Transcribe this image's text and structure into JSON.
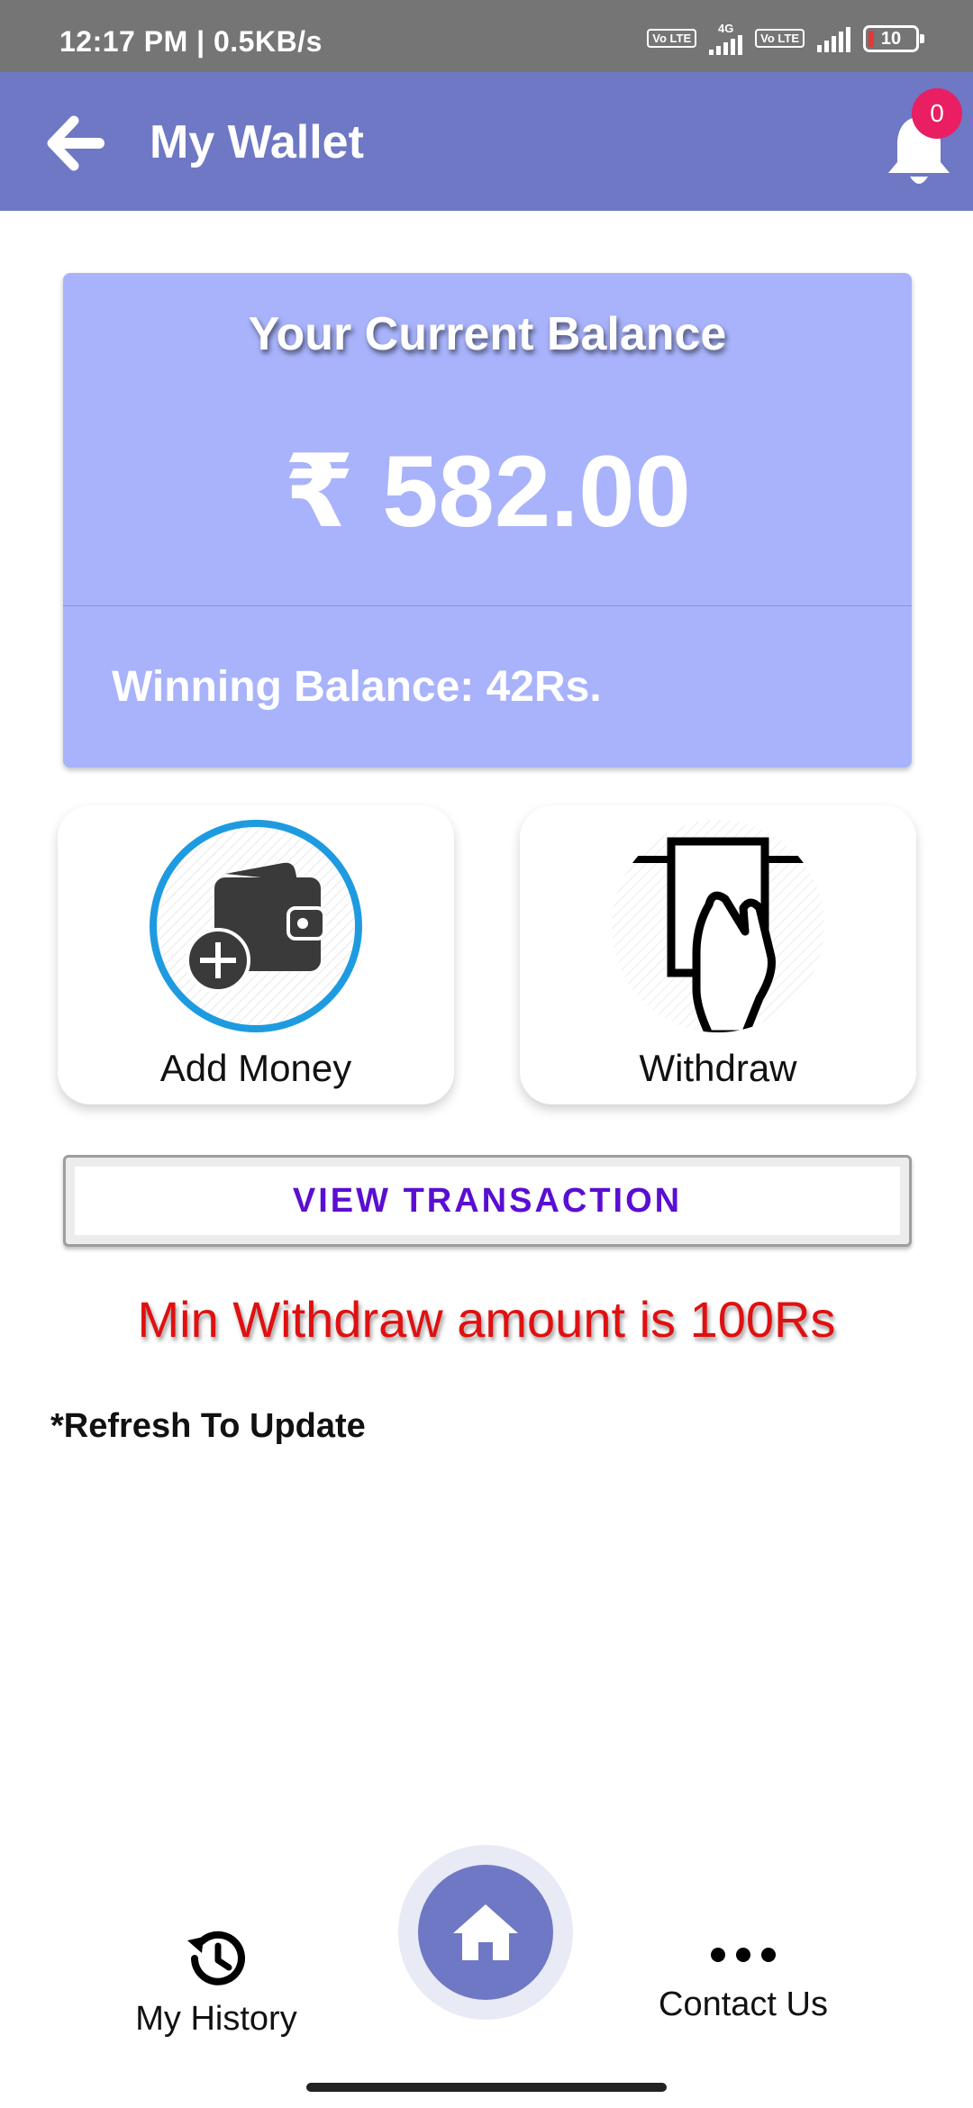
{
  "status_bar": {
    "time": "12:17 PM | 0.5KB/s",
    "volte_1": "Vo LTE",
    "network_1": "4G",
    "volte_2": "Vo LTE",
    "battery": "10"
  },
  "header": {
    "title": "My Wallet",
    "notification_count": "0"
  },
  "balance": {
    "title": "Your Current Balance",
    "amount": "₹ 582.00",
    "winning": "Winning Balance: 42Rs."
  },
  "actions": {
    "add_money": "Add Money",
    "withdraw": "Withdraw"
  },
  "view_transaction": "VIEW TRANSACTION",
  "min_withdraw_note": "Min Withdraw amount is 100Rs",
  "refresh_note": "*Refresh To Update",
  "bottom_nav": {
    "history": "My History",
    "contact": "Contact Us"
  },
  "colors": {
    "app_bar": "#6e78c4",
    "balance_card": "#a8b3fb",
    "badge": "#e91e63",
    "accent_text": "#5a0ed1",
    "warning": "#e01010",
    "add_ring": "#1e9be0"
  },
  "icons": {
    "back": "arrow-left-icon",
    "notification": "bell-icon",
    "add_money": "wallet-plus-icon",
    "withdraw": "cash-withdraw-icon",
    "history": "history-icon",
    "home": "home-icon",
    "contact": "more-dots-icon"
  }
}
